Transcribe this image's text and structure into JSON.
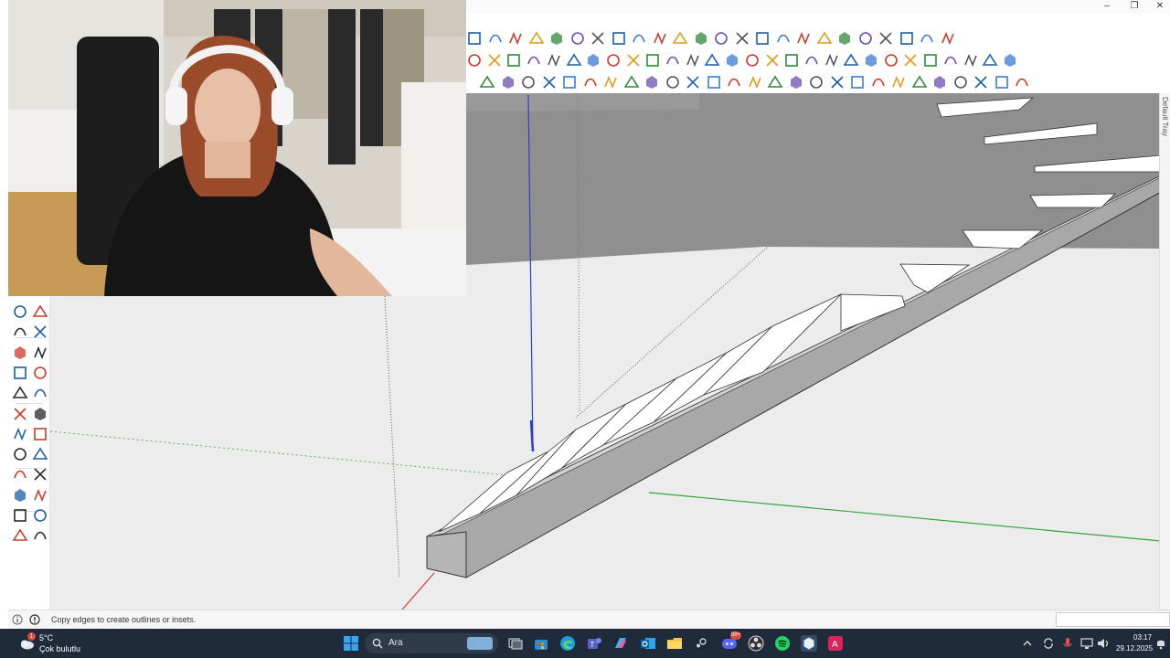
{
  "window": {
    "minimize_icon": "minimize-icon",
    "maximize_icon": "maximize-icon",
    "close_icon": "close-icon"
  },
  "toolbar_rows": [
    {
      "name": "standard-toolbar",
      "count": 24
    },
    {
      "name": "drawing-toolbar",
      "count": 28
    },
    {
      "name": "edit-toolbar",
      "count": 27
    }
  ],
  "tray": {
    "label": "Default Tray"
  },
  "left_palette": {
    "tools": [
      "select-rectangle-icon",
      "pointer-icon",
      "pan-icon",
      "triangle-icon",
      "paint-icon",
      "eraser-icon",
      "line-icon",
      "text-icon",
      "orbit-icon",
      "axes-icon",
      "move-icon",
      "rotate-icon",
      "zoom-icon",
      "zoom-window-icon",
      "zoom-extents-icon",
      "previous-view-icon",
      "walk-icon",
      "position-camera-icon",
      "look-around-icon",
      "section-plane-icon",
      "components-icon",
      "styles-icon",
      "layers-icon",
      "scenes-icon"
    ]
  },
  "status": {
    "info_icon": "info-icon",
    "help_icon": "help-icon",
    "message": "Copy edges to create outlines or insets.",
    "measurements_value": ""
  },
  "taskbar": {
    "weather_temp": "5°C",
    "weather_condition": "Çok bulutlu",
    "weather_badge": "1",
    "search_placeholder": "Ara",
    "apps": [
      "start-icon",
      "search-icon",
      "task-view-icon",
      "store-icon",
      "edge-icon",
      "teams-icon",
      "copilot-icon",
      "outlook-icon",
      "file-explorer-icon",
      "steam-icon",
      "discord-icon",
      "obs-icon",
      "spotify-icon",
      "sketchup-icon",
      "app-icon"
    ],
    "discord_badge": "99+",
    "tray_icons": [
      "chevron-up-icon",
      "sync-icon",
      "mic-icon",
      "network-icon",
      "volume-icon"
    ],
    "time": "03:17",
    "date": "29.12.2025"
  },
  "colors": {
    "viewport_ground": "#ececec",
    "viewport_wall": "#8f8f8f",
    "stair_face": "#a8a8a8",
    "axis_red": "#d43a3a",
    "axis_green": "#2ea836",
    "axis_blue": "#2c3fc7",
    "taskbar": "#1f2b3a"
  }
}
